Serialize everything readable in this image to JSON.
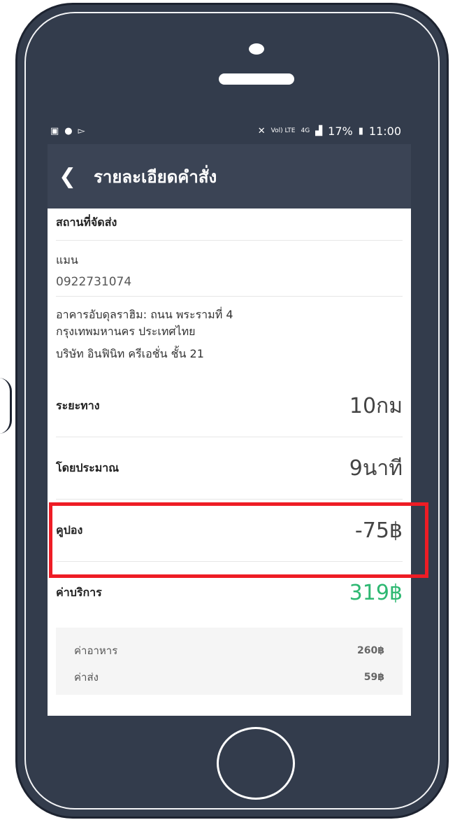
{
  "status_bar": {
    "left_icons": [
      "image-icon",
      "line-chat-icon",
      "cast-icon"
    ],
    "signal_labels": [
      "Vol) LTE",
      "4G"
    ],
    "battery": "17%",
    "time": "11:00"
  },
  "app_bar": {
    "title": "รายละเอียดคำสั่ง"
  },
  "delivery": {
    "section_title": "สถานที่จัดส่ง",
    "name": "แมน",
    "phone": "0922731074",
    "address_line1": "อาคารอับดุลราฮิม: ถนน พระรามที่ 4",
    "address_line2": "กรุงเทพมหานคร ประเทศไทย",
    "address_line3": "บริษัท อินฟินิท ครีเอชั่น ชั้น 21"
  },
  "summary": {
    "distance_label": "ระยะทาง",
    "distance_value": "10กม",
    "eta_label": "โดยประมาณ",
    "eta_value": "9นาที",
    "coupon_label": "คูปอง",
    "coupon_value": "-75฿",
    "service_label": "ค่าบริการ",
    "service_value": "319฿"
  },
  "breakdown": {
    "food_label": "ค่าอาหาร",
    "food_value": "260฿",
    "delivery_label": "ค่าส่ง",
    "delivery_value": "59฿"
  },
  "colors": {
    "frame": "#333c4c",
    "app_bar": "#3b4455",
    "highlight": "#ee1c25",
    "total_green": "#2eb872"
  }
}
